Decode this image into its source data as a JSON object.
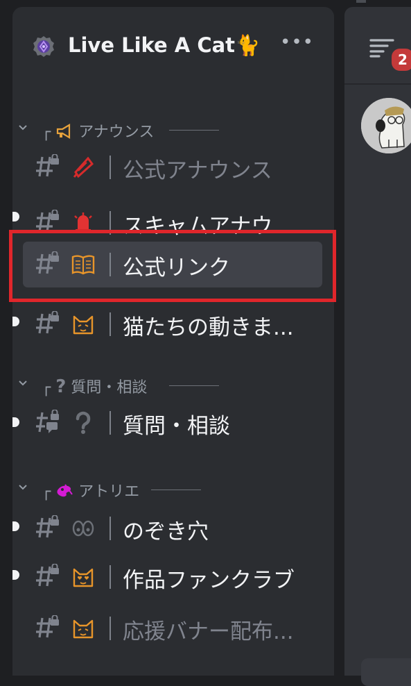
{
  "server": {
    "name": "Live Like A Cat🐈",
    "more_label": "•••",
    "icon": "server-badge-icon"
  },
  "categories": [
    {
      "prefix": "┌",
      "icon": "megaphone-icon",
      "label": "アナウンス"
    },
    {
      "prefix": "┌",
      "icon": "question-icon",
      "label": "質問・相談"
    },
    {
      "prefix": "┌",
      "icon": "paint-icon",
      "label": "アトリエ"
    }
  ],
  "channels": [
    {
      "name": "公式アナウンス",
      "emoji": "megaphone-icon",
      "locked": true,
      "unread": false,
      "muted": true,
      "selected": false
    },
    {
      "name": "スキャムアナウ...",
      "emoji": "siren-icon",
      "locked": true,
      "unread": true,
      "muted": false,
      "selected": false
    },
    {
      "name": "公式リンク",
      "emoji": "book-icon",
      "locked": true,
      "unread": false,
      "muted": false,
      "selected": true
    },
    {
      "name": "猫たちの動きま...",
      "emoji": "cat-face-icon",
      "locked": true,
      "unread": true,
      "muted": false,
      "selected": false
    },
    {
      "name": "質問・相談",
      "emoji": "question-icon",
      "locked": true,
      "unread": true,
      "muted": false,
      "selected": false,
      "forum": true
    },
    {
      "name": "のぞき穴",
      "emoji": "eyes-icon",
      "locked": true,
      "unread": true,
      "muted": false,
      "selected": false
    },
    {
      "name": "作品ファンクラブ",
      "emoji": "heart-eyes-cat-icon",
      "locked": true,
      "unread": true,
      "muted": false,
      "selected": false
    },
    {
      "name": "応援バナー配布...",
      "emoji": "cat-face-icon",
      "locked": true,
      "unread": false,
      "muted": true,
      "selected": false
    }
  ],
  "right_panel": {
    "notification_count": "2",
    "icon": "member-list-icon"
  },
  "colors": {
    "sidebar_bg": "#2b2d31",
    "selected_bg": "#404249",
    "highlight_border": "#e0262b",
    "badge_bg": "#c43a3a"
  }
}
